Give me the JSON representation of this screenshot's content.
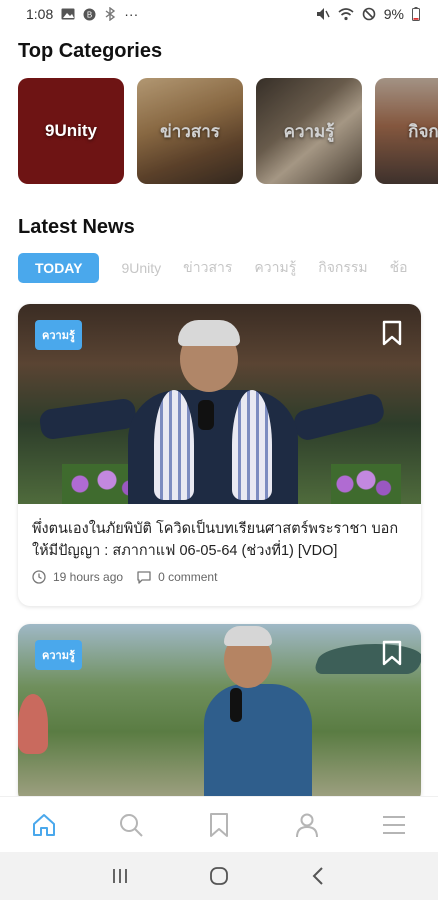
{
  "status_bar": {
    "time": "1:08",
    "more": "···",
    "battery": "9%"
  },
  "sections": {
    "top_categories": "Top Categories",
    "latest_news": "Latest News"
  },
  "categories": [
    {
      "label": "9Unity"
    },
    {
      "label": "ข่าวสาร"
    },
    {
      "label": "ความรู้"
    },
    {
      "label": "กิจกร"
    }
  ],
  "tabs": [
    "TODAY",
    "9Unity",
    "ข่าวสาร",
    "ความรู้",
    "กิจกรรม",
    "ช้อ"
  ],
  "news": [
    {
      "badge": "ความรู้",
      "title": "พึ่งตนเองในภัยพิบัติ โควิดเป็นบทเรียนศาสตร์พระราชา บอกให้มีปัญญา : สภากาแฟ 06-05-64 (ช่วงที่1) [VDO]",
      "time": "19 hours ago",
      "comments": "0 comment"
    },
    {
      "badge": "ความรู้"
    }
  ],
  "icons": {
    "status": [
      "gallery-icon",
      "notification-icon",
      "bluetooth-icon",
      "mute-icon",
      "wifi-icon",
      "blocked-icon",
      "battery-icon"
    ],
    "nav": [
      "home-icon",
      "search-icon",
      "bookmark-icon",
      "profile-icon",
      "menu-icon"
    ],
    "system": [
      "recents-icon",
      "home-circle-icon",
      "back-icon"
    ]
  },
  "colors": {
    "accent": "#4aa8ec",
    "category_9unity": "#6e1414"
  }
}
